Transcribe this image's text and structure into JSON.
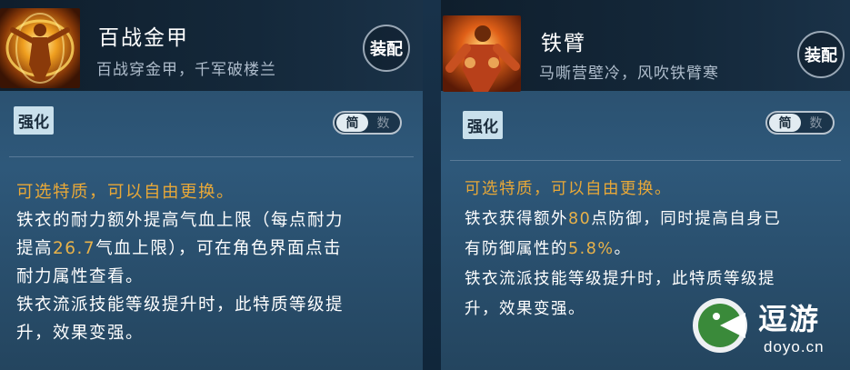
{
  "cards": [
    {
      "name": "百战金甲",
      "description": "百战穿金甲，千军破楼兰",
      "equip_button": "装配",
      "tag": "强化",
      "toggle": {
        "selected": "简",
        "other": "数"
      },
      "body": {
        "intro": "可选特质，可以自由更换。",
        "line1": "铁衣的耐力额外提高气血上限（每点耐力",
        "line2_pre": "提高",
        "line2_num": "26.7",
        "line2_post": "气血上限），可在角色界面点击",
        "line3": "耐力属性查看。",
        "line4": "铁衣流派技能等级提升时，此特质等级提",
        "line5": "升，效果变强。"
      }
    },
    {
      "name": "铁臂",
      "description": "马嘶营壁冷，风吹铁臂寒",
      "equip_button": "装配",
      "tag": "强化",
      "toggle": {
        "selected": "简",
        "other": "数"
      },
      "body": {
        "intro": "可选特质，可以自由更换。",
        "line1_pre": "铁衣获得额外",
        "line1_num": "80",
        "line1_post": "点防御，同时提高自身已",
        "line2_pre": "有防御属性的",
        "line2_num": "5.8%",
        "line2_post": "。",
        "line3": "铁衣流派技能等级提升时，此特质等级提",
        "line4": "升，效果变强。"
      }
    }
  ],
  "watermark": {
    "text": "逗游",
    "domain": "doyo.cn",
    "icon": "doyo-logo-icon"
  },
  "colors": {
    "accent": "#e8a838",
    "tag_bg": "#c9e0ec",
    "panel": "#2e587a"
  }
}
